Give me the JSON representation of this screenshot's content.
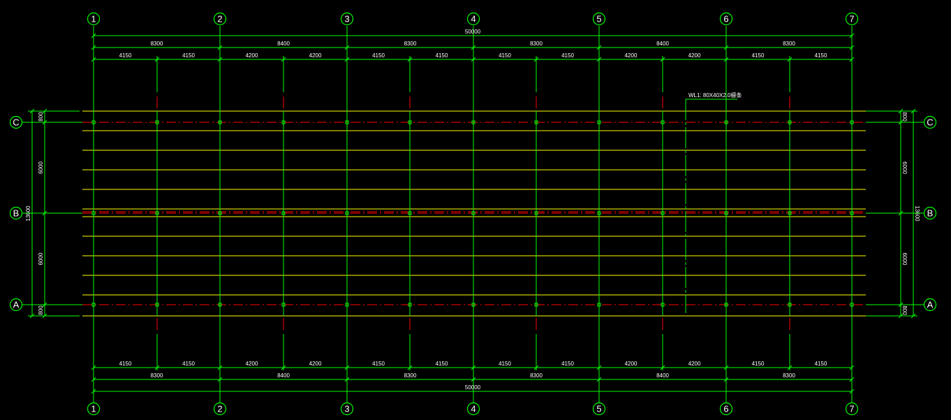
{
  "drawing": {
    "colors": {
      "background": "#000000",
      "grid": "#00ff00",
      "purlin": "#ffff00",
      "axis": "#ff0000",
      "text": "#ffffff"
    },
    "column_axes": [
      "1",
      "2",
      "3",
      "4",
      "5",
      "6",
      "7"
    ],
    "row_axes": [
      "C",
      "B",
      "A"
    ],
    "top_dims": {
      "total": "50000",
      "bays": [
        "8300",
        "8400",
        "8300",
        "8300",
        "8400",
        "8300"
      ],
      "halves": [
        "4150",
        "4150",
        "4200",
        "4200",
        "4150",
        "4150",
        "4150",
        "4150",
        "4200",
        "4200",
        "4150",
        "4150"
      ]
    },
    "bottom_dims": {
      "total": "50000",
      "bays": [
        "8300",
        "8400",
        "8300",
        "8300",
        "8400",
        "8300"
      ],
      "halves": [
        "4150",
        "4150",
        "4200",
        "4200",
        "4150",
        "4150",
        "4150",
        "4150",
        "4200",
        "4200",
        "4150",
        "4150"
      ]
    },
    "left_dims": {
      "total": "13600",
      "segments": [
        "800",
        "6000",
        "6000",
        "800"
      ]
    },
    "right_dims": {
      "total": "13600",
      "segments": [
        "800",
        "6000",
        "6000",
        "800"
      ]
    },
    "annotation": "WL1: 80X40X2.0檩条"
  }
}
